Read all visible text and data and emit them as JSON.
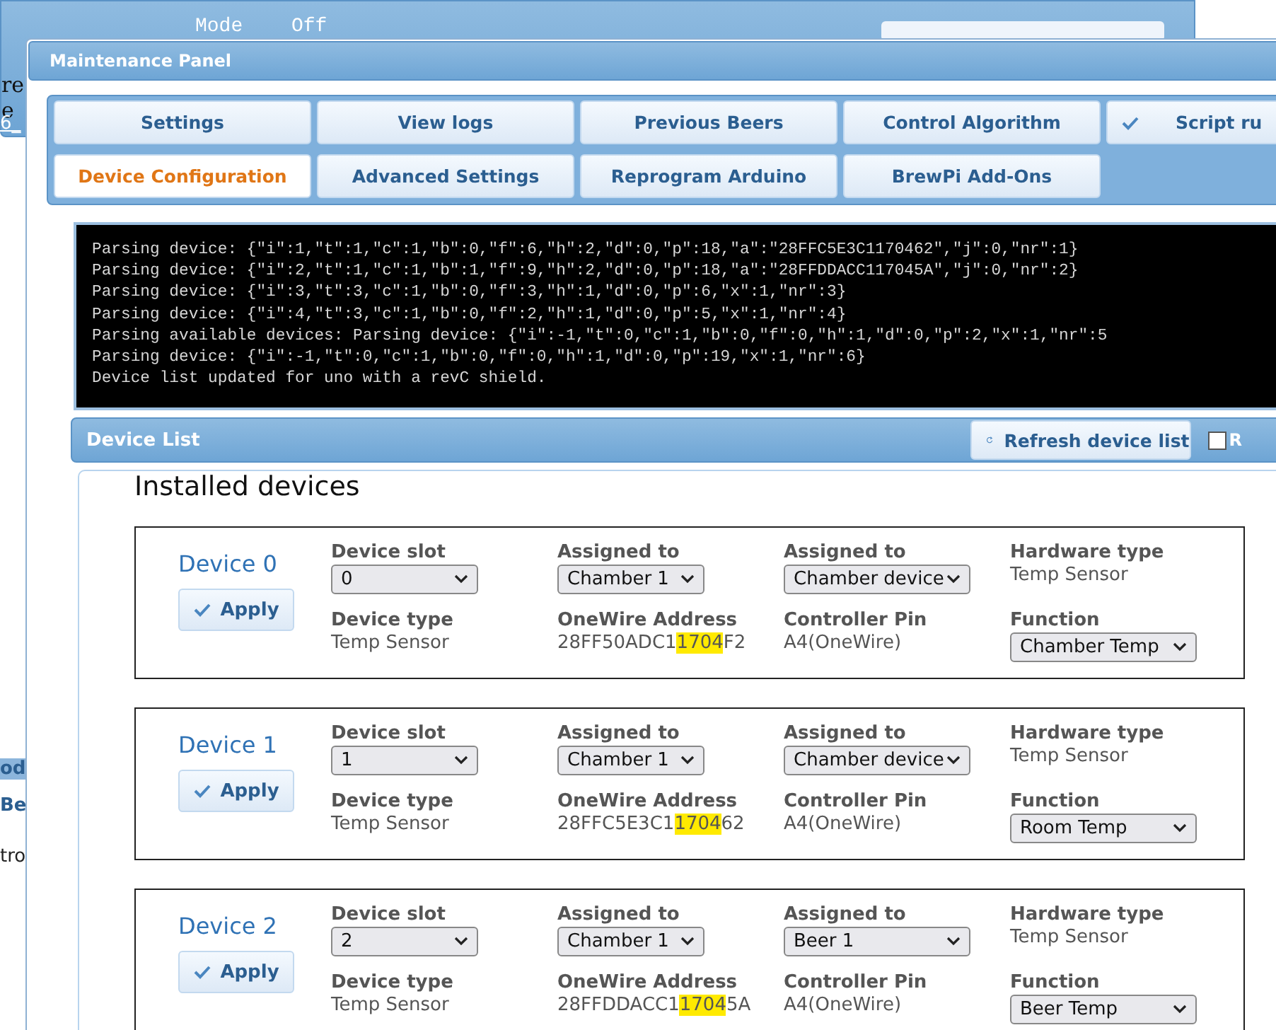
{
  "background_page": {
    "logo_fragments": [
      "re",
      "e"
    ],
    "mode_label": "Mode",
    "mode_value": "Off",
    "side_fragments": [
      "6_",
      "od",
      "Be",
      "tro"
    ]
  },
  "window": {
    "title": "Maintenance Panel"
  },
  "tabs": [
    {
      "label": "Settings",
      "selected": false,
      "checked": false
    },
    {
      "label": "View logs",
      "selected": false,
      "checked": false
    },
    {
      "label": "Previous Beers",
      "selected": false,
      "checked": false
    },
    {
      "label": "Control Algorithm",
      "selected": false,
      "checked": false
    },
    {
      "label": "Script ru",
      "selected": false,
      "checked": true
    },
    {
      "label": "Device Configuration",
      "selected": true,
      "checked": false
    },
    {
      "label": "Advanced Settings",
      "selected": false,
      "checked": false
    },
    {
      "label": "Reprogram Arduino",
      "selected": false,
      "checked": false
    },
    {
      "label": "BrewPi Add-Ons",
      "selected": false,
      "checked": false
    }
  ],
  "console": {
    "lines": [
      "Parsing device: {\"i\":1,\"t\":1,\"c\":1,\"b\":0,\"f\":6,\"h\":2,\"d\":0,\"p\":18,\"a\":\"28FFC5E3C1170462\",\"j\":0,\"nr\":1}",
      "Parsing device: {\"i\":2,\"t\":1,\"c\":1,\"b\":1,\"f\":9,\"h\":2,\"d\":0,\"p\":18,\"a\":\"28FFDDACC117045A\",\"j\":0,\"nr\":2}",
      "Parsing device: {\"i\":3,\"t\":3,\"c\":1,\"b\":0,\"f\":3,\"h\":1,\"d\":0,\"p\":6,\"x\":1,\"nr\":3}",
      "Parsing device: {\"i\":4,\"t\":3,\"c\":1,\"b\":0,\"f\":2,\"h\":1,\"d\":0,\"p\":5,\"x\":1,\"nr\":4}",
      "Parsing available devices: Parsing device: {\"i\":-1,\"t\":0,\"c\":1,\"b\":0,\"f\":0,\"h\":1,\"d\":0,\"p\":2,\"x\":1,\"nr\":5",
      "Parsing device: {\"i\":-1,\"t\":0,\"c\":1,\"b\":0,\"f\":0,\"h\":1,\"d\":0,\"p\":19,\"x\":1,\"nr\":6}",
      "Device list updated for uno with a revC shield."
    ]
  },
  "device_list": {
    "header": "Device List",
    "refresh_button": "Refresh device list",
    "option_label": "R",
    "option_checked": false,
    "heading": "Installed devices",
    "devices": [
      {
        "name": "Device 0",
        "apply": "Apply",
        "fields": [
          {
            "kind": "select",
            "label": "Device slot",
            "value": "0"
          },
          {
            "kind": "select",
            "label": "Assigned to",
            "value": "Chamber 1"
          },
          {
            "kind": "select",
            "label": "Assigned to",
            "value": "Chamber device"
          },
          {
            "kind": "text",
            "label": "Hardware type",
            "value": "Temp Sensor"
          },
          {
            "kind": "text",
            "label": "Device type",
            "value": "Temp Sensor"
          },
          {
            "kind": "address",
            "label": "OneWire Address",
            "before": "28FF50ADC1",
            "highlight": "1704",
            "after": "F2"
          },
          {
            "kind": "text",
            "label": "Controller Pin",
            "value": "A4(OneWire)"
          },
          {
            "kind": "select",
            "label": "Function",
            "value": "Chamber Temp"
          }
        ]
      },
      {
        "name": "Device 1",
        "apply": "Apply",
        "fields": [
          {
            "kind": "select",
            "label": "Device slot",
            "value": "1"
          },
          {
            "kind": "select",
            "label": "Assigned to",
            "value": "Chamber 1"
          },
          {
            "kind": "select",
            "label": "Assigned to",
            "value": "Chamber device"
          },
          {
            "kind": "text",
            "label": "Hardware type",
            "value": "Temp Sensor"
          },
          {
            "kind": "text",
            "label": "Device type",
            "value": "Temp Sensor"
          },
          {
            "kind": "address",
            "label": "OneWire Address",
            "before": "28FFC5E3C1",
            "highlight": "1704",
            "after": "62"
          },
          {
            "kind": "text",
            "label": "Controller Pin",
            "value": "A4(OneWire)"
          },
          {
            "kind": "select",
            "label": "Function",
            "value": "Room Temp"
          }
        ]
      },
      {
        "name": "Device 2",
        "apply": "Apply",
        "fields": [
          {
            "kind": "select",
            "label": "Device slot",
            "value": "2"
          },
          {
            "kind": "select",
            "label": "Assigned to",
            "value": "Chamber 1"
          },
          {
            "kind": "select",
            "label": "Assigned to",
            "value": "Beer 1"
          },
          {
            "kind": "text",
            "label": "Hardware type",
            "value": "Temp Sensor"
          },
          {
            "kind": "text",
            "label": "Device type",
            "value": "Temp Sensor"
          },
          {
            "kind": "address",
            "label": "OneWire Address",
            "before": "28FFDDACC1",
            "highlight": "1704",
            "after": "5A"
          },
          {
            "kind": "text",
            "label": "Controller Pin",
            "value": "A4(OneWire)"
          },
          {
            "kind": "select",
            "label": "Function",
            "value": "Beer Temp"
          }
        ]
      }
    ]
  }
}
